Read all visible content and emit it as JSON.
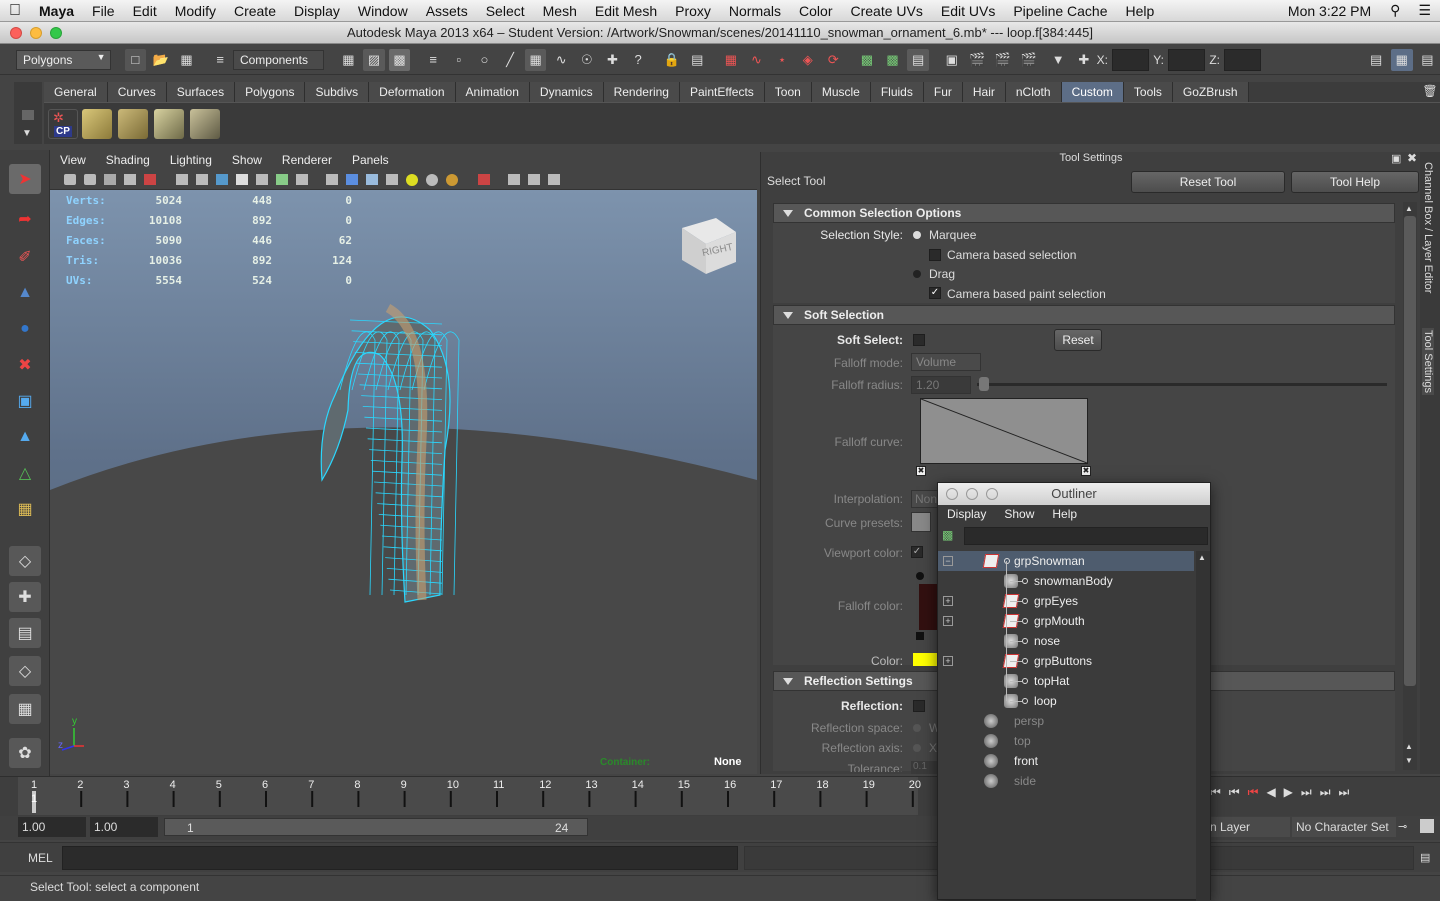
{
  "mac_menu": {
    "app": "Maya",
    "items": [
      "File",
      "Edit",
      "Modify",
      "Create",
      "Display",
      "Window",
      "Assets",
      "Select",
      "Mesh",
      "Edit Mesh",
      "Proxy",
      "Normals",
      "Color",
      "Create UVs",
      "Edit UVs",
      "Pipeline Cache",
      "Help"
    ],
    "clock": "Mon 3:22 PM"
  },
  "window_title": "Autodesk Maya 2013 x64 – Student Version: /Artwork/Snowman/scenes/20141110_snowman_ornament_6.mb*  ---  loop.f[384:445]",
  "status_line": {
    "menu_set": "Polygons",
    "selection_mode": "Components",
    "x_label": "X:",
    "y_label": "Y:",
    "z_label": "Z:"
  },
  "shelf_tabs": [
    "General",
    "Curves",
    "Surfaces",
    "Polygons",
    "Subdivs",
    "Deformation",
    "Animation",
    "Dynamics",
    "Rendering",
    "PaintEffects",
    "Toon",
    "Muscle",
    "Fluids",
    "Fur",
    "Hair",
    "nCloth",
    "Custom",
    "Tools",
    "GoZBrush"
  ],
  "shelf_active": "Custom",
  "shelf_first_icon_label": "CP",
  "viewport": {
    "menu": [
      "View",
      "Shading",
      "Lighting",
      "Show",
      "Renderer",
      "Panels"
    ],
    "hud": [
      {
        "label": "Verts:",
        "v1": "5024",
        "v2": "448",
        "v3": "0"
      },
      {
        "label": "Edges:",
        "v1": "10108",
        "v2": "892",
        "v3": "0"
      },
      {
        "label": "Faces:",
        "v1": "5090",
        "v2": "446",
        "v3": "62"
      },
      {
        "label": "Tris:",
        "v1": "10036",
        "v2": "892",
        "v3": "124"
      },
      {
        "label": "UVs:",
        "v1": "5554",
        "v2": "524",
        "v3": "0"
      }
    ],
    "view_cube_label": "RIGHT",
    "container_label": "Container:",
    "container_value": "None",
    "axis_y": "y",
    "axis_z": "z"
  },
  "tool_settings": {
    "title": "Tool Settings",
    "tool_name": "Select Tool",
    "reset_button": "Reset Tool",
    "help_button": "Tool Help",
    "common_section": "Common Selection Options",
    "selection_style_label": "Selection Style:",
    "marquee": "Marquee",
    "camera_based_selection": "Camera based selection",
    "drag": "Drag",
    "camera_based_paint": "Camera based paint selection",
    "soft_section": "Soft Selection",
    "soft_select_label": "Soft Select:",
    "soft_reset": "Reset",
    "falloff_mode_label": "Falloff mode:",
    "falloff_mode_value": "Volume",
    "falloff_radius_label": "Falloff radius:",
    "falloff_radius_value": "1.20",
    "falloff_curve_label": "Falloff curve:",
    "interpolation_label": "Interpolation:",
    "interpolation_value": "Non",
    "curve_presets_label": "Curve presets:",
    "viewport_color_label": "Viewport color:",
    "falloff_color_label": "Falloff color:",
    "color_label": "Color:",
    "color_value": "#ffff00",
    "reflection_section": "Reflection Settings",
    "reflection_label": "Reflection:",
    "reflection_space_label": "Reflection space:",
    "reflection_space_value": "W",
    "reflection_axis_label": "Reflection axis:",
    "reflection_axis_value": "X",
    "tolerance_label": "Tolerance:",
    "tolerance_value": "0.1"
  },
  "right_tabs": {
    "channel_box": "Channel Box / Layer Editor",
    "tool_settings": "Tool Settings"
  },
  "timeline": {
    "ticks": [
      "1",
      "2",
      "3",
      "4",
      "5",
      "6",
      "7",
      "8",
      "9",
      "10",
      "11",
      "12",
      "13",
      "14",
      "15",
      "16",
      "17",
      "18",
      "19",
      "20"
    ],
    "current_frame": "1"
  },
  "range": {
    "start": "1.00",
    "playback_start": "1.00",
    "slider_start": "1",
    "slider_end": "24",
    "anim_layer": "n Layer",
    "character_set": "No Character Set"
  },
  "mel": {
    "label": "MEL"
  },
  "help_line": "Select Tool: select a component",
  "outliner": {
    "title": "Outliner",
    "menu": [
      "Display",
      "Show",
      "Help"
    ],
    "items": [
      {
        "name": "grpSnowman",
        "indent": 0,
        "expandable": true,
        "selected": true,
        "dim": false,
        "kind": "group"
      },
      {
        "name": "snowmanBody",
        "indent": 1,
        "expandable": false,
        "selected": false,
        "dim": false,
        "kind": "mesh"
      },
      {
        "name": "grpEyes",
        "indent": 1,
        "expandable": true,
        "selected": false,
        "dim": false,
        "kind": "group"
      },
      {
        "name": "grpMouth",
        "indent": 1,
        "expandable": true,
        "selected": false,
        "dim": false,
        "kind": "group"
      },
      {
        "name": "nose",
        "indent": 1,
        "expandable": false,
        "selected": false,
        "dim": false,
        "kind": "mesh"
      },
      {
        "name": "grpButtons",
        "indent": 1,
        "expandable": true,
        "selected": false,
        "dim": false,
        "kind": "group"
      },
      {
        "name": "topHat",
        "indent": 1,
        "expandable": false,
        "selected": false,
        "dim": false,
        "kind": "mesh"
      },
      {
        "name": "loop",
        "indent": 1,
        "expandable": false,
        "selected": false,
        "dim": false,
        "kind": "mesh"
      },
      {
        "name": "persp",
        "indent": 0,
        "expandable": false,
        "selected": false,
        "dim": true,
        "kind": "camera"
      },
      {
        "name": "top",
        "indent": 0,
        "expandable": false,
        "selected": false,
        "dim": true,
        "kind": "camera"
      },
      {
        "name": "front",
        "indent": 0,
        "expandable": false,
        "selected": false,
        "dim": false,
        "kind": "camera"
      },
      {
        "name": "side",
        "indent": 0,
        "expandable": false,
        "selected": false,
        "dim": true,
        "kind": "camera"
      }
    ]
  }
}
